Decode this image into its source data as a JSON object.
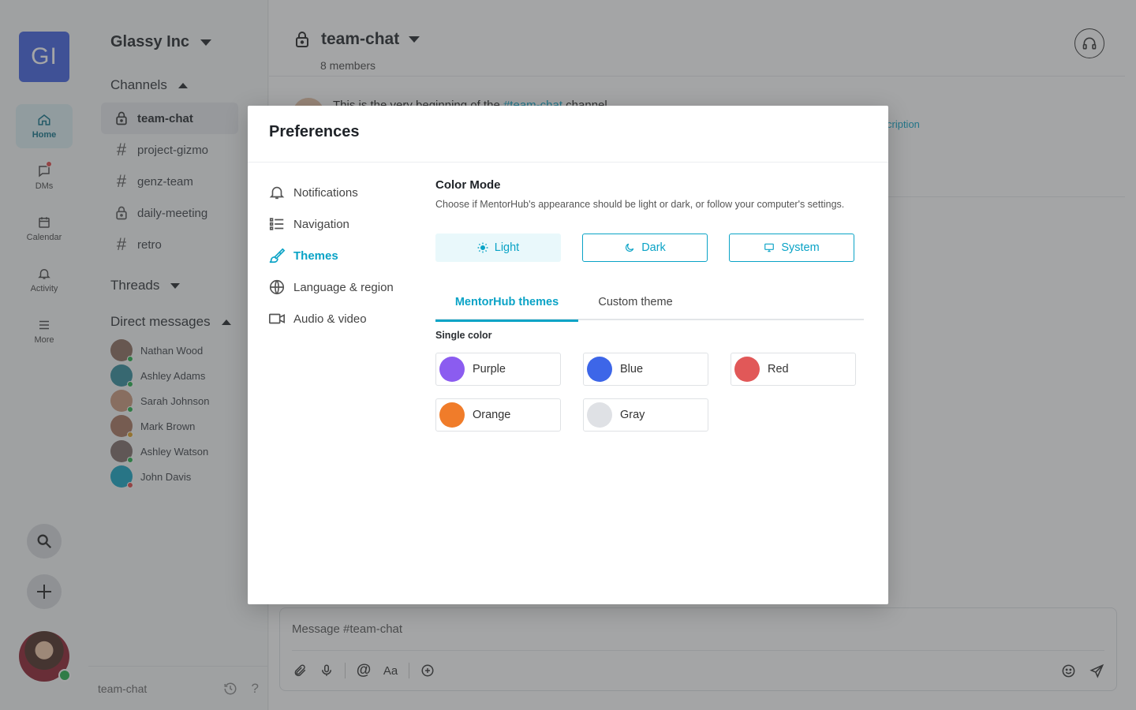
{
  "rail": {
    "workspace_initials": "GI",
    "items": [
      {
        "label": "Home"
      },
      {
        "label": "DMs"
      },
      {
        "label": "Calendar"
      },
      {
        "label": "Activity"
      },
      {
        "label": "More"
      }
    ]
  },
  "sidebar": {
    "workspace_name": "Glassy Inc",
    "channels_title": "Channels",
    "channels": [
      {
        "name": "team-chat",
        "type": "private"
      },
      {
        "name": "project-gizmo",
        "type": "public"
      },
      {
        "name": "genz-team",
        "type": "public"
      },
      {
        "name": "daily-meeting",
        "type": "private"
      },
      {
        "name": "retro",
        "type": "public"
      }
    ],
    "threads_title": "Threads",
    "dms_title": "Direct messages",
    "dms": [
      {
        "name": "Nathan Wood",
        "status_color": "#22b04a",
        "avatar_color": "#8a6a5a"
      },
      {
        "name": "Ashley Adams",
        "status_color": "#22b04a",
        "avatar_color": "#2f8a9a"
      },
      {
        "name": "Sarah Johnson",
        "status_color": "#22b04a",
        "avatar_color": "#c9967a"
      },
      {
        "name": "Mark Brown",
        "status_color": "#e0a020",
        "avatar_color": "#a8745c"
      },
      {
        "name": "Ashley Watson",
        "status_color": "#22b04a",
        "avatar_color": "#7d6a66"
      },
      {
        "name": "John Davis",
        "status_color": "#e04848",
        "avatar_color": "#12a3c2"
      }
    ],
    "footer_channel": "team-chat"
  },
  "main": {
    "channel_name": "team-chat",
    "members": "8 members",
    "intro_prefix": "This is the very beginning of the ",
    "intro_channel": "#team-chat",
    "intro_suffix": " channel",
    "intro_desc_link": "cription",
    "composer_placeholder": "Message #team-chat"
  },
  "modal": {
    "title": "Preferences",
    "nav": [
      {
        "label": "Notifications",
        "icon": "bell-icon"
      },
      {
        "label": "Navigation",
        "icon": "list-icon"
      },
      {
        "label": "Themes",
        "icon": "brush-icon"
      },
      {
        "label": "Language & region",
        "icon": "globe-icon"
      },
      {
        "label": "Audio & video",
        "icon": "video-icon"
      }
    ],
    "color_mode_title": "Color Mode",
    "color_mode_desc": "Choose if MentorHub's appearance should be light or dark, or follow your computer's settings.",
    "modes": [
      {
        "label": "Light",
        "icon": "sun-icon"
      },
      {
        "label": "Dark",
        "icon": "moon-icon"
      },
      {
        "label": "System",
        "icon": "monitor-icon"
      }
    ],
    "tabs": [
      {
        "label": "MentorHub themes"
      },
      {
        "label": "Custom theme"
      }
    ],
    "single_color_title": "Single color",
    "swatches": [
      {
        "label": "Purple",
        "color": "#8b5cf0"
      },
      {
        "label": "Blue",
        "color": "#3d66e8"
      },
      {
        "label": "Red",
        "color": "#e15858"
      },
      {
        "label": "Orange",
        "color": "#f07c2a"
      },
      {
        "label": "Gray",
        "color": "#dfe1e5"
      }
    ]
  },
  "colors": {
    "accent": "#0aa3c6",
    "workspace_logo": "#3f5ee0",
    "overlay": "rgba(64,66,70,0.48)"
  }
}
